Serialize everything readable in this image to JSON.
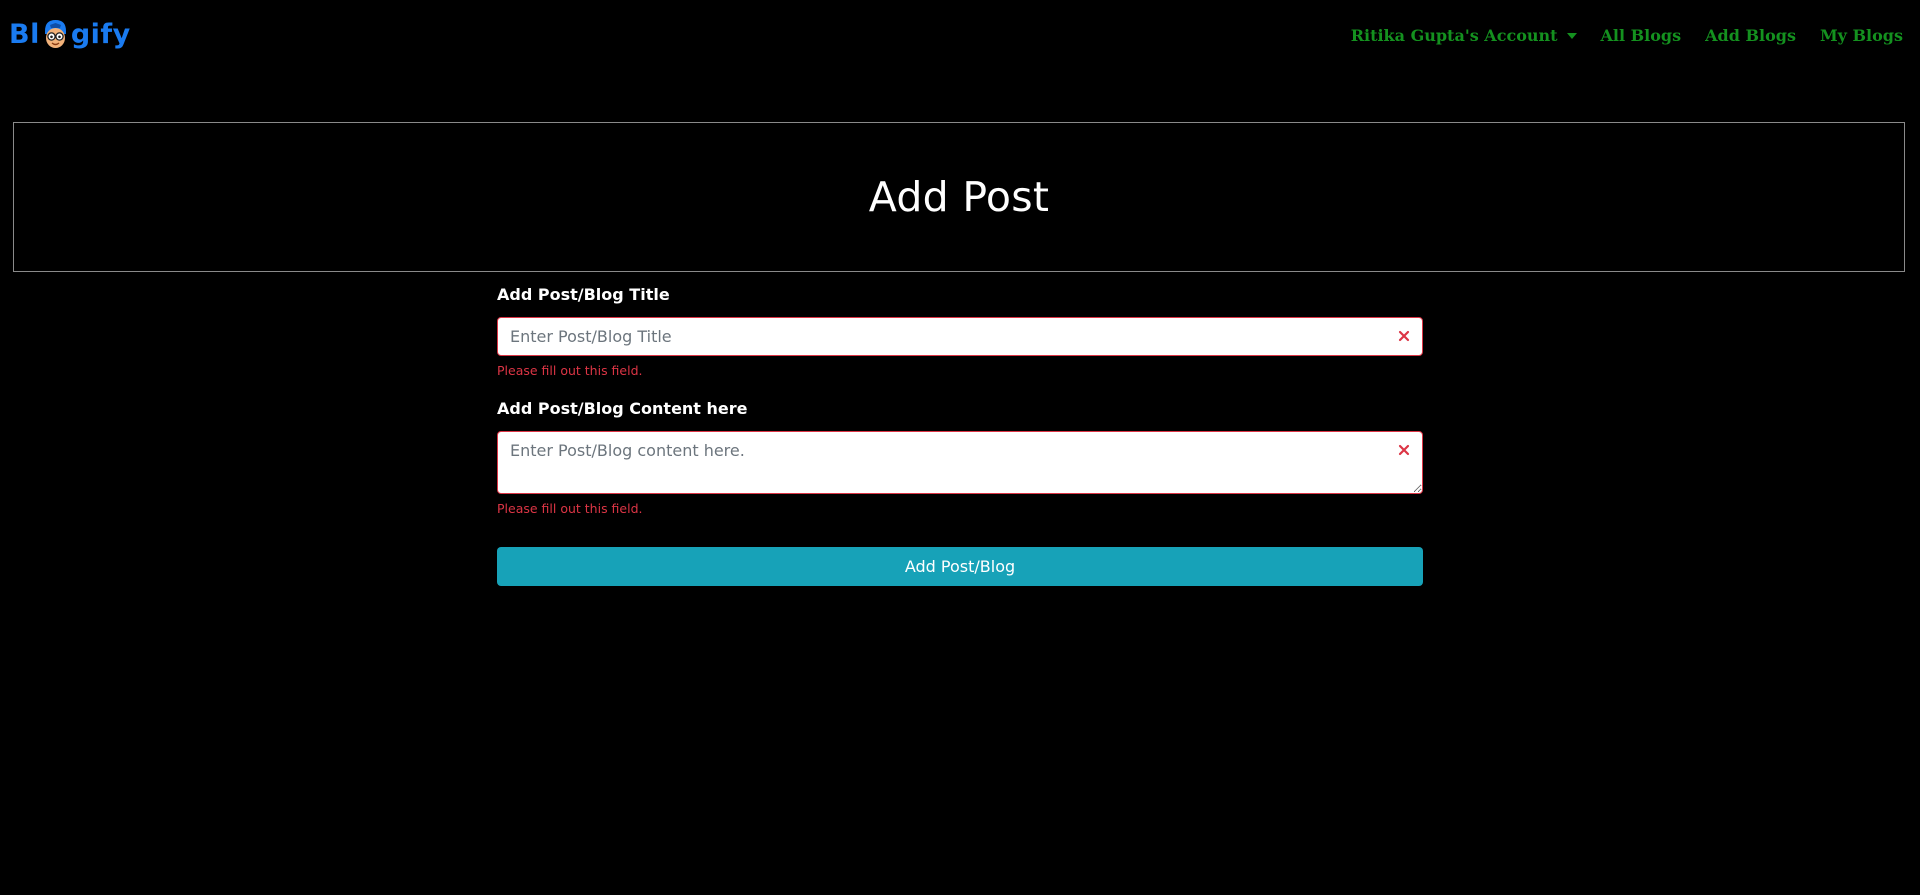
{
  "navbar": {
    "brand": {
      "prefix": "Bl",
      "suffix": "gify",
      "logo_icon": "cartoon-face-logo-icon"
    },
    "links": [
      {
        "label": "Ritika Gupta's Account",
        "has_dropdown": true,
        "icon": "caret-down-icon"
      },
      {
        "label": "All Blogs"
      },
      {
        "label": "Add Blogs"
      },
      {
        "label": "My Blogs"
      }
    ],
    "link_color": "#14911f",
    "brand_color": "#1a7bf0"
  },
  "header": {
    "title": "Add Post"
  },
  "form": {
    "title_field": {
      "label": "Add Post/Blog Title",
      "placeholder": "Enter Post/Blog Title",
      "value": "",
      "invalid_icon": "x-icon",
      "error": "Please fill out this field."
    },
    "content_field": {
      "label": "Add Post/Blog Content here",
      "placeholder": "Enter Post/Blog content here.",
      "value": "",
      "invalid_icon": "x-icon",
      "error": "Please fill out this field."
    },
    "submit_label": "Add Post/Blog",
    "error_color": "#dc3545",
    "button_color": "#17a2b8"
  }
}
